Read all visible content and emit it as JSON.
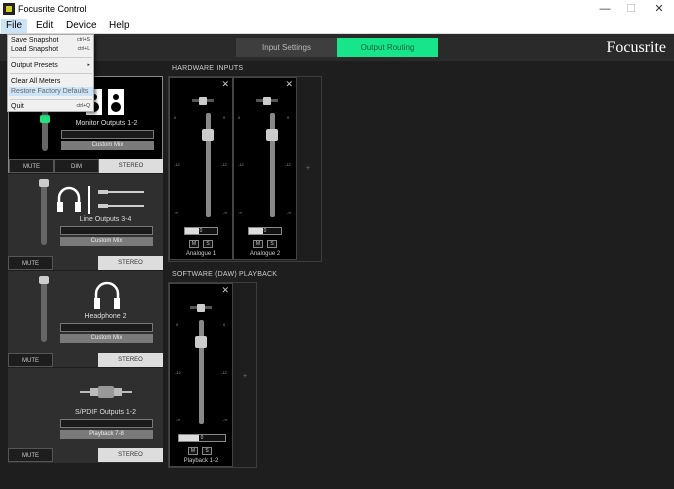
{
  "window": {
    "title": "Focusrite Control",
    "minimize": "—",
    "maximize": "☐",
    "close": "✕"
  },
  "menubar": {
    "items": [
      {
        "label": "File"
      },
      {
        "label": "Edit"
      },
      {
        "label": "Device"
      },
      {
        "label": "Help"
      }
    ]
  },
  "file_menu": {
    "items": [
      {
        "label": "Save Snapshot",
        "shortcut": "ctrl+S"
      },
      {
        "label": "Load Snapshot",
        "shortcut": "ctrl+L"
      },
      {
        "label": "Output Presets",
        "arrow": "▸"
      },
      {
        "label": "Clear All Meters"
      },
      {
        "label": "Restore Factory Defaults"
      },
      {
        "label": "Quit",
        "shortcut": "ctrl+Q"
      }
    ]
  },
  "header": {
    "tabs": [
      {
        "label": "Input Settings",
        "active": false
      },
      {
        "label": "Output Routing",
        "active": true
      }
    ],
    "brand": "Focusrite",
    "accent_color": "#17e58a"
  },
  "outputs": [
    {
      "name": "Monitor Outputs 1-2",
      "source": "Custom Mix",
      "mute": "MUTE",
      "dim": "DIM",
      "mode": "STEREO",
      "icon": "speakers-icon",
      "level": 0.85
    },
    {
      "name": "Line Outputs 3-4",
      "source": "Custom Mix",
      "mute": "MUTE",
      "mode": "STEREO",
      "icon": "headphones-and-cables-icon",
      "level": 0.9
    },
    {
      "name": "Headphone 2",
      "source": "Custom Mix",
      "mute": "MUTE",
      "mode": "STEREO",
      "icon": "headphones-icon",
      "level": 0.9
    },
    {
      "name": "S/PDIF Outputs 1-2",
      "source": "Playback 7-8",
      "mute": "MUTE",
      "mode": "STEREO",
      "icon": "spdif-cable-icon"
    }
  ],
  "hardware_inputs": {
    "label": "HARDWARE INPUTS",
    "add": "+",
    "channels": [
      {
        "name": "Analogue 1",
        "gain": "0",
        "mute": "M",
        "solo": "S",
        "scale": [
          "0",
          "-12",
          "-∞"
        ],
        "fader": 0.75
      },
      {
        "name": "Analogue 2",
        "gain": "0",
        "mute": "M",
        "solo": "S",
        "scale": [
          "0",
          "-12",
          "-∞"
        ],
        "fader": 0.75
      }
    ]
  },
  "daw_playback": {
    "label": "SOFTWARE (DAW) PLAYBACK",
    "add": "+",
    "channels": [
      {
        "name": "Playback 1-2",
        "gain": "0",
        "mute": "M",
        "solo": "S",
        "scale": [
          "0",
          "-12",
          "-∞"
        ],
        "fader": 0.75
      }
    ]
  }
}
